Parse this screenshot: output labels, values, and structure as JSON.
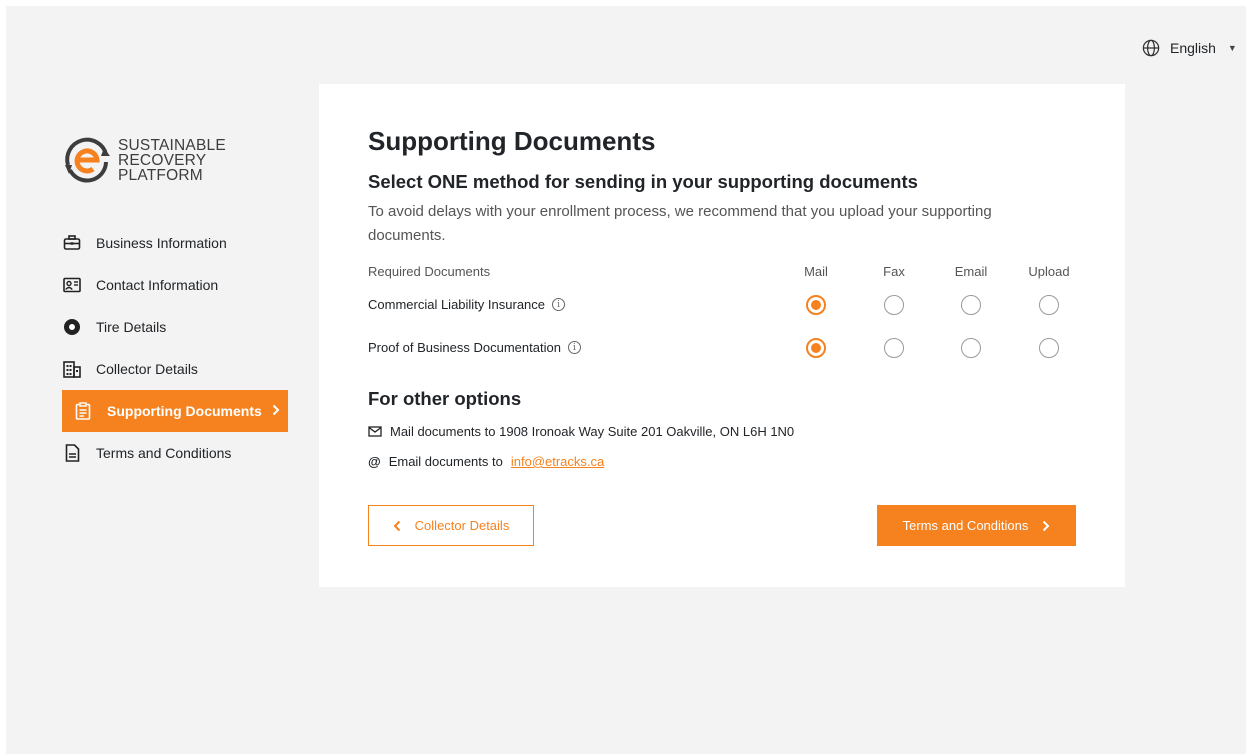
{
  "language": {
    "label": "English"
  },
  "logo": {
    "line1": "SUSTAINABLE",
    "line2": "RECOVERY",
    "line3": "PLATFORM"
  },
  "sidebar": {
    "items": [
      {
        "label": "Business Information",
        "icon": "briefcase-icon"
      },
      {
        "label": "Contact Information",
        "icon": "id-card-icon"
      },
      {
        "label": "Tire Details",
        "icon": "tire-icon"
      },
      {
        "label": "Collector Details",
        "icon": "building-icon"
      },
      {
        "label": "Supporting Documents",
        "icon": "clipboard-icon",
        "active": true
      },
      {
        "label": "Terms and Conditions",
        "icon": "document-icon"
      }
    ]
  },
  "main": {
    "title": "Supporting Documents",
    "subtitle": "Select ONE method for sending in your supporting documents",
    "description": "To avoid delays with your enrollment process, we recommend that you upload your supporting documents.",
    "table": {
      "headers": [
        "Required Documents",
        "Mail",
        "Fax",
        "Email",
        "Upload"
      ],
      "rows": [
        {
          "label": "Commercial Liability Insurance",
          "selected": "Mail"
        },
        {
          "label": "Proof of Business Documentation",
          "selected": "Mail"
        }
      ]
    },
    "other_title": "For other options",
    "mail_text": "Mail documents to 1908 Ironoak Way Suite 201 Oakville, ON L6H 1N0",
    "email_prefix": "Email documents to",
    "email_link": "info@etracks.ca",
    "back_button": "Collector Details",
    "next_button": "Terms and Conditions"
  },
  "colors": {
    "accent": "#f5821f",
    "background": "#f3f3f3",
    "card": "#ffffff"
  }
}
